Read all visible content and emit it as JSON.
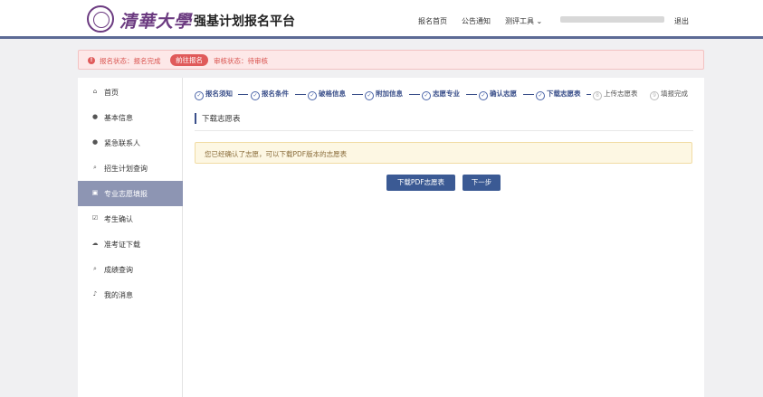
{
  "header": {
    "logo_text": "清華大學",
    "site_title": "强基计划报名平台",
    "nav": [
      {
        "label": "报名首页",
        "name": "nav-home"
      },
      {
        "label": "公告通知",
        "name": "nav-notices"
      },
      {
        "label": "测评工具 ⌄",
        "name": "nav-tools"
      }
    ],
    "logout": "退出"
  },
  "alert": {
    "icon": "!",
    "status_text": "报名状态：报名完成",
    "goto_button": "前往报名",
    "review_text": "审核状态：待审核"
  },
  "sidebar": {
    "items": [
      {
        "label": "首页",
        "icon": "home-icon",
        "glyph": "⌂"
      },
      {
        "label": "基本信息",
        "icon": "user-icon",
        "glyph": "●"
      },
      {
        "label": "紧急联系人",
        "icon": "user-icon",
        "glyph": "●"
      },
      {
        "label": "招生计划查询",
        "icon": "search-icon",
        "glyph": "⌕"
      },
      {
        "label": "专业志愿填报",
        "icon": "form-icon",
        "glyph": "▣"
      },
      {
        "label": "考生确认",
        "icon": "check-doc-icon",
        "glyph": "☑"
      },
      {
        "label": "准考证下载",
        "icon": "cloud-download-icon",
        "glyph": "☁"
      },
      {
        "label": "成绩查询",
        "icon": "search-icon",
        "glyph": "⌕"
      },
      {
        "label": "我的消息",
        "icon": "bell-icon",
        "glyph": "♪"
      }
    ]
  },
  "steps": [
    {
      "label": "报名须知",
      "mark": "✓"
    },
    {
      "label": "报名条件",
      "mark": "✓"
    },
    {
      "label": "破格信息",
      "mark": "✓"
    },
    {
      "label": "附加信息",
      "mark": "✓"
    },
    {
      "label": "志愿专业",
      "mark": "✓"
    },
    {
      "label": "确认志愿",
      "mark": "✓"
    },
    {
      "label": "下载志愿表",
      "mark": "✓"
    },
    {
      "label": "上传志愿表",
      "mark": "8"
    },
    {
      "label": "填报完成",
      "mark": "9"
    }
  ],
  "main": {
    "section_title": "下载志愿表",
    "notice": "您已经确认了志愿，可以下载PDF版本的志愿表",
    "download_button": "下载PDF志愿表",
    "next_button": "下一步"
  },
  "colors": {
    "brand": "#6b3a80",
    "primary": "#3b5a94",
    "active_nav": "#8d95b3",
    "alert_bg": "#fde8e8",
    "alert_text": "#d9534f",
    "notice_bg": "#fdf7e3"
  }
}
